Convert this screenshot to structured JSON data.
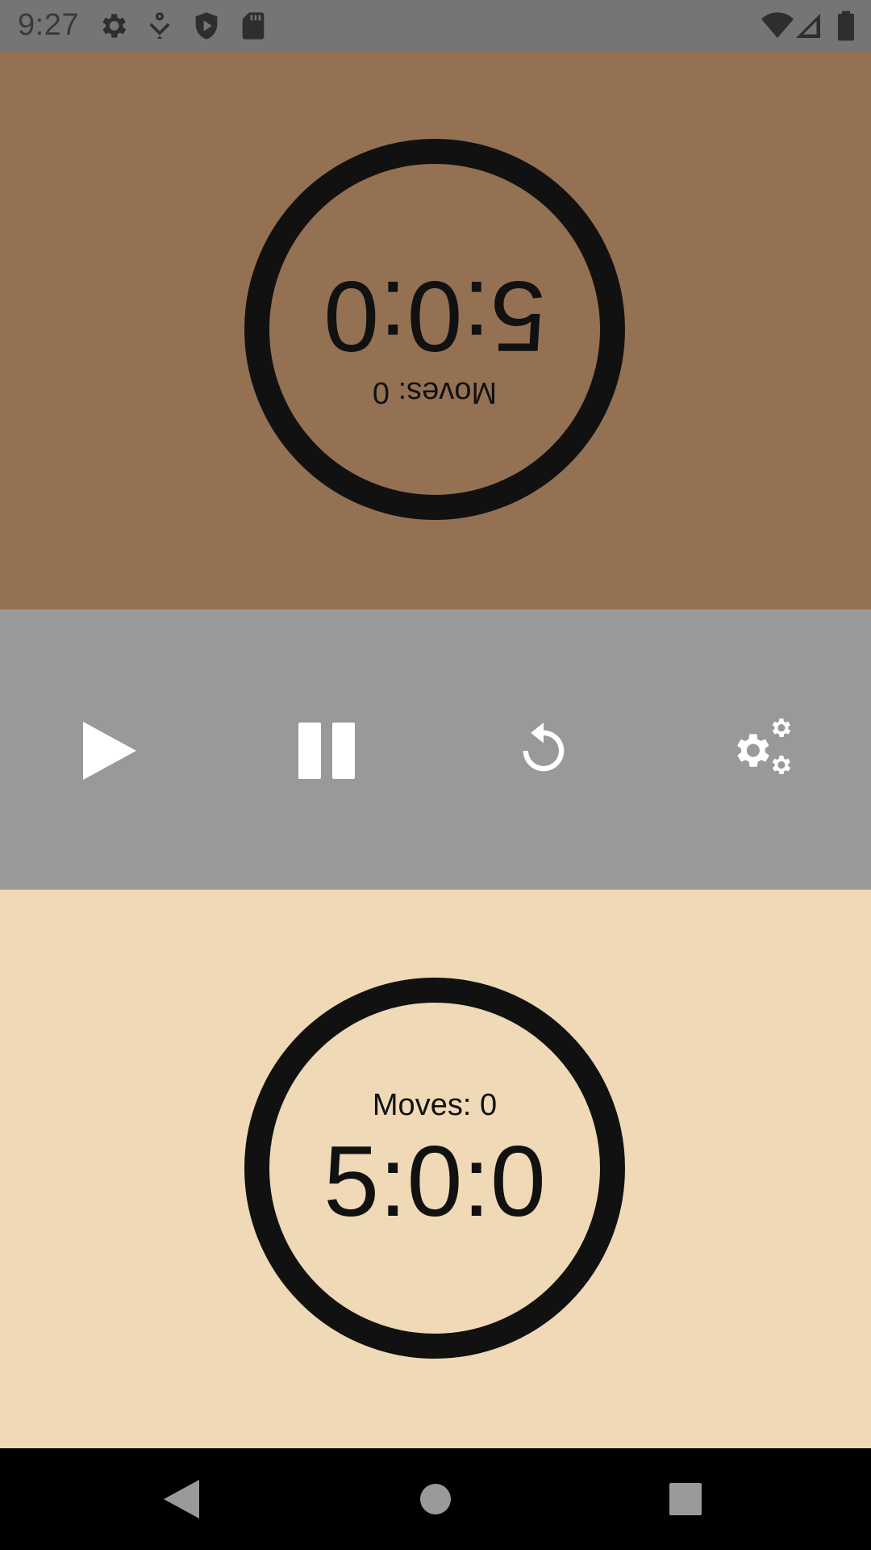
{
  "status_bar": {
    "time": "9:27",
    "left_icons": [
      "settings-gear-icon",
      "download-notification-icon",
      "shield-play-icon",
      "sd-card-icon"
    ],
    "right_icons": [
      "wifi-icon",
      "signal-icon",
      "battery-icon"
    ]
  },
  "top_player": {
    "time": "5:0:0",
    "moves": "Moves: 0",
    "background_color": "#957154"
  },
  "bottom_player": {
    "time": "5:0:0",
    "moves": "Moves: 0",
    "background_color": "#efd9b6"
  },
  "controls": {
    "background_color": "#999999",
    "buttons": [
      "play-icon",
      "pause-icon",
      "reset-icon",
      "settings-icon"
    ]
  },
  "nav_bar": {
    "buttons": [
      "back-icon",
      "home-icon",
      "recents-icon"
    ]
  }
}
